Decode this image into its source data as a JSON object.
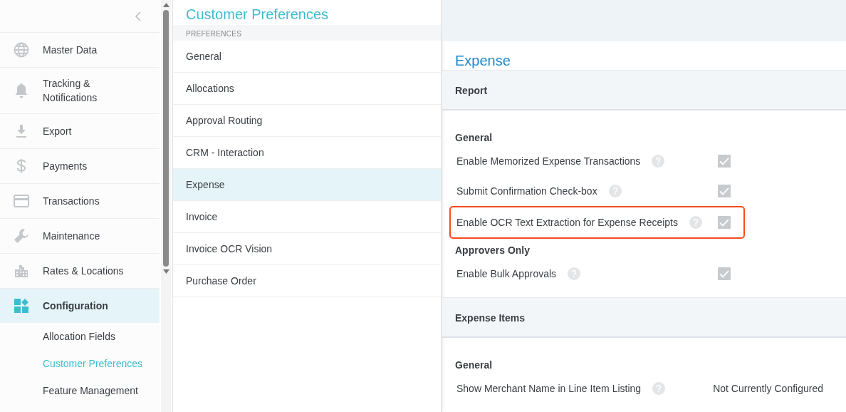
{
  "sidebar": {
    "items": [
      {
        "label": "Master Data",
        "selected": false
      },
      {
        "label": "Tracking & Notifications",
        "selected": false
      },
      {
        "label": "Export",
        "selected": false
      },
      {
        "label": "Payments",
        "selected": false
      },
      {
        "label": "Transactions",
        "selected": false
      },
      {
        "label": "Maintenance",
        "selected": false
      },
      {
        "label": "Rates & Locations",
        "selected": false
      },
      {
        "label": "Configuration",
        "selected": true,
        "children": [
          {
            "label": "Allocation Fields",
            "selected": false
          },
          {
            "label": "Customer Preferences",
            "selected": true
          },
          {
            "label": "Feature Management",
            "selected": false
          }
        ]
      }
    ]
  },
  "middle": {
    "title": "Customer Preferences",
    "section": "PREFERENCES",
    "items": [
      {
        "label": "General",
        "selected": false
      },
      {
        "label": "Allocations",
        "selected": false
      },
      {
        "label": "Approval Routing",
        "selected": false
      },
      {
        "label": "CRM - Interaction",
        "selected": false
      },
      {
        "label": "Expense",
        "selected": true
      },
      {
        "label": "Invoice",
        "selected": false
      },
      {
        "label": "Invoice OCR Vision",
        "selected": false
      },
      {
        "label": "Purchase Order",
        "selected": false
      }
    ]
  },
  "detail": {
    "title": "Expense",
    "sections": [
      {
        "title": "Report",
        "groups": [
          {
            "title": "General",
            "settings": [
              {
                "kind": "checkbox",
                "label": "Enable Memorized Expense Transactions",
                "checked": true,
                "highlighted": false
              },
              {
                "kind": "checkbox",
                "label": "Submit Confirmation Check-box",
                "checked": true,
                "highlighted": false
              },
              {
                "kind": "checkbox",
                "label": "Enable OCR Text Extraction for Expense Receipts",
                "checked": true,
                "highlighted": true
              }
            ]
          },
          {
            "title": "Approvers Only",
            "settings": [
              {
                "kind": "checkbox",
                "label": "Enable Bulk Approvals",
                "checked": true,
                "highlighted": false
              }
            ]
          }
        ]
      },
      {
        "title": "Expense Items",
        "groups": [
          {
            "title": "General",
            "settings": [
              {
                "kind": "text",
                "label": "Show Merchant Name in Line Item Listing",
                "value": "Not Currently Configured",
                "highlighted": false
              }
            ]
          }
        ]
      }
    ]
  }
}
